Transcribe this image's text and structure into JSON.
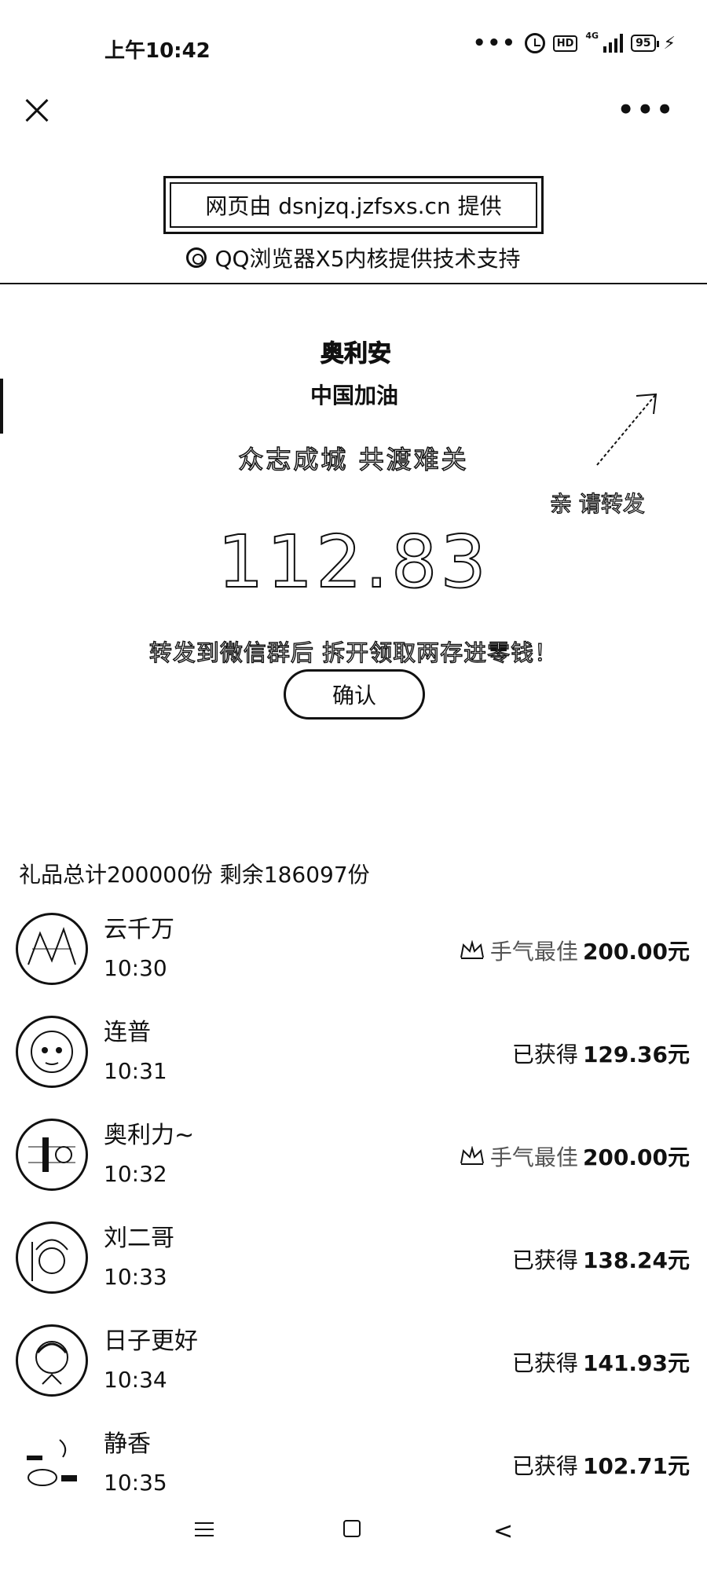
{
  "status_bar": {
    "time": "上午10:42",
    "network": "4G",
    "battery": "95",
    "icons": [
      "more-dots-icon",
      "alarm-icon",
      "hd-icon",
      "signal-icon",
      "battery-icon",
      "charging-icon"
    ]
  },
  "nav": {
    "close_icon": "close-icon",
    "more_icon": "more-dots-icon"
  },
  "provider": {
    "text": "网页由 dsnjzq.jzfsxs.cn 提供",
    "browser_note": "QQ浏览器X5内核提供技术支持"
  },
  "hero": {
    "logo_badge": "奥利安",
    "logo_sub": "中国加油",
    "slogan": "众志成城 共渡难关",
    "share_label": "亲 请转发",
    "amount": "112.83",
    "hint": "转发到微信群后 拆开领取两存进零钱！",
    "confirm_label": "确认"
  },
  "summary": "礼品总计200000份 剩余186097份",
  "recipients": [
    {
      "name": "云千万",
      "time": "10:30",
      "label": "手气最佳",
      "amount": "200.00元",
      "best": true
    },
    {
      "name": "连普",
      "time": "10:31",
      "label": "已获得",
      "amount": "129.36元",
      "best": false
    },
    {
      "name": "奥利力~",
      "time": "10:32",
      "label": "手气最佳",
      "amount": "200.00元",
      "best": true
    },
    {
      "name": "刘二哥",
      "time": "10:33",
      "label": "已获得",
      "amount": "138.24元",
      "best": false
    },
    {
      "name": "日子更好",
      "time": "10:34",
      "label": "已获得",
      "amount": "141.93元",
      "best": false
    },
    {
      "name": "静香",
      "time": "10:35",
      "label": "已获得",
      "amount": "102.71元",
      "best": false
    }
  ],
  "bottom_nav": {
    "back_glyph": "<",
    "icons": [
      "menu-icon",
      "home-icon",
      "back-icon"
    ]
  }
}
